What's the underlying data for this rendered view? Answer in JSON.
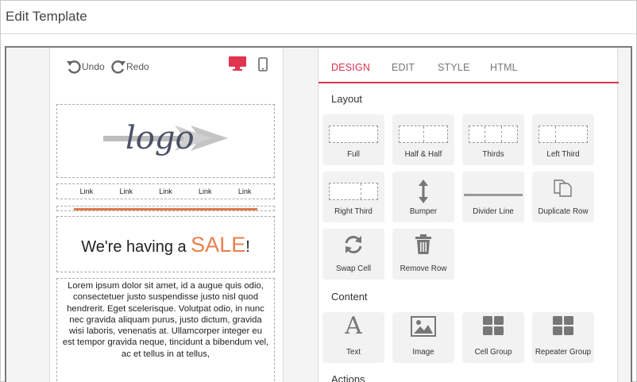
{
  "header": {
    "title": "Edit Template"
  },
  "toolbar": {
    "undo_label": "Undo",
    "redo_label": "Redo"
  },
  "colors": {
    "accent": "#d8334f",
    "sale": "#e8804f",
    "divider": "#e07b4e"
  },
  "preview": {
    "logo_text": "logo",
    "links": [
      "Link",
      "Link",
      "Link",
      "Link",
      "Link"
    ],
    "sale_prefix": "We're having a ",
    "sale_word": "SALE",
    "sale_suffix": "!",
    "body_text": "Lorem ipsum dolor sit amet, id a augue quis odio, consectetuer justo suspendisse justo nisl quod hendrerit. Eget scelerisque. Volutpat odio, in nunc nec gravida aliquam purus, justo dictum, gravida wisi laboris, venenatis at. Ullamcorper integer eu est tempor gravida neque, tincidunt a bibendum vel, ac et tellus in at tellus, "
  },
  "tabs": [
    "DESIGN",
    "EDIT",
    "STYLE",
    "HTML"
  ],
  "sections": {
    "layout": "Layout",
    "content": "Content",
    "actions": "Actions"
  },
  "layout_tiles": [
    "Full",
    "Half & Half",
    "Thirds",
    "Left Third",
    "Right Third",
    "Bumper",
    "Divider Line",
    "Duplicate Row",
    "Swap Cell",
    "Remove Row"
  ],
  "content_tiles": [
    "Text",
    "Image",
    "Cell Group",
    "Repeater Group"
  ],
  "icons": {
    "undo": "undo-icon",
    "redo": "redo-icon",
    "desktop": "desktop-icon",
    "mobile": "mobile-icon",
    "bumper": "vertical-arrows-icon",
    "duplicate": "copy-icon",
    "swap": "refresh-icon",
    "remove": "trash-icon",
    "text": "letter-a-icon",
    "image": "image-icon",
    "cell_group": "grid-icon",
    "repeater_group": "grid-icon"
  }
}
